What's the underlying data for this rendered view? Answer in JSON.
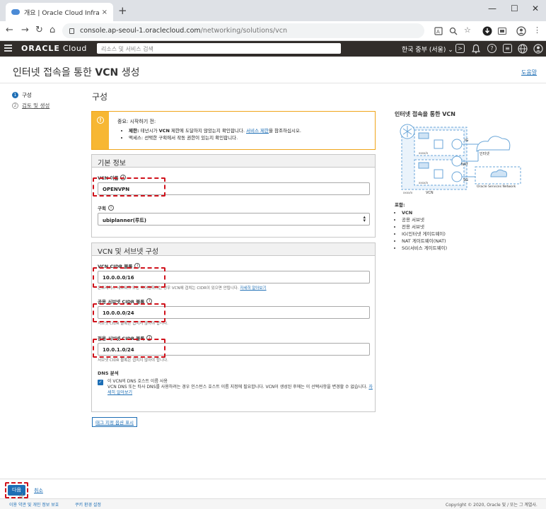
{
  "browser": {
    "tab_title": "개요 | Oracle Cloud Infrastructu",
    "tab_close": "×",
    "new_tab": "+",
    "url_host": "console.ap-seoul-1.oraclecloud.com",
    "url_path": "/networking/solutions/vcn",
    "back": "←",
    "forward": "→",
    "reload": "↻",
    "home": "⌂",
    "minimize": "—",
    "maximize": "☐",
    "close": "✕"
  },
  "oci_header": {
    "logo_brand": "ORACLE",
    "logo_product": "Cloud",
    "search_placeholder": "리소스 및 서비스 검색",
    "region": "한국 중부 (서울)"
  },
  "page": {
    "title_prefix": "인터넷 접속을 통한",
    "title_bold": "VCN",
    "title_suffix": "생성",
    "help": "도움말"
  },
  "steps": [
    {
      "num": "1",
      "label": "구성"
    },
    {
      "num": "2",
      "label": "검토 및 생성"
    }
  ],
  "main": {
    "section_title": "구성",
    "notice": {
      "title": "중요: 시작하기 전:",
      "item1_bold": "제한:",
      "item1_a": "테넌시가",
      "item1_vcn": "VCN",
      "item1_b": "제한에 도달하지 않았는지 확인합니다.",
      "item1_link": "서비스 제한",
      "item1_c": "을 참조하십시오.",
      "item2": "액세스: 선택한 구획에서 작동 권한이 있는지 확인합니다."
    },
    "basic": {
      "heading": "기본 정보",
      "vcn_name_label": "VCN 이름",
      "vcn_name_value": "OPENVPN",
      "compartment_label": "구획",
      "compartment_value": "ubiplanner(루트)"
    },
    "subnets": {
      "heading": "VCN 및 서브넷 구성",
      "vcn_cidr_label": "VCN CIDR 블록",
      "vcn_cidr_value": "10.0.0.0/16",
      "vcn_cidr_help": "온프레미스 네트워크 또는 피어링하려는 경우 VCN에 겹치는 CIDR이 있으면 안됩니다.",
      "vcn_cidr_help_link": "자세히 알아보기",
      "public_cidr_label": "공용 서브넷 CIDR 블록",
      "public_cidr_value": "10.0.0.0/24",
      "public_cidr_help": "서브넷 CIDR 블록은 겹치지 않아야 합니다.",
      "private_cidr_label": "전용 서브넷 CIDR 블록",
      "private_cidr_value": "10.0.1.0/24",
      "private_cidr_help": "서브넷 CIDR 블록은 겹치지 않아야 합니다.",
      "dns_label": "DNS 분석",
      "dns_check_text": "이 VCN의 DNS 호스트 이름 사용",
      "dns_check_help": "VCN DNS 또는 타사 DNS를 사용하려는 경우 인스턴스 호스트 이름 지정에 필요합니다. VCN이 생성된 후에는 이 선택사항을 변경할 수 없습니다.",
      "dns_help_link": "자세히 알아보기"
    },
    "tag_options": "태그 지정 옵션 표시"
  },
  "side": {
    "title": "인터넷 접속을 통한 VCN",
    "diagram": {
      "ig": "IG",
      "nat": "NAT",
      "sg": "SG",
      "internet": "인터넷",
      "osn": "Oracle Services Network",
      "vcn": "VCN",
      "cidr_a": "xxxx/x",
      "cidr_b": "xxxx/x",
      "cidr_c": "xxxx/x"
    },
    "includes": "포함:",
    "items": [
      "VCN",
      "공용 서브넷",
      "전용 서브넷",
      "IG(인터넷 게이트웨이)",
      "NAT 게이트웨이(NAT)",
      "SG(서비스 게이트웨이)"
    ]
  },
  "actions": {
    "next": "다음",
    "cancel": "취소"
  },
  "footer": {
    "terms": "이용 약관 및 개인 정보 보호",
    "cookies": "쿠키 환경 설정",
    "copyright": "Copyright © 2020, Oracle 및 / 또는 그 계열사."
  },
  "colors": {
    "accent": "#1d6eb5",
    "warning": "#f7b733",
    "highlight": "#d0121b",
    "header": "#312d2a"
  }
}
